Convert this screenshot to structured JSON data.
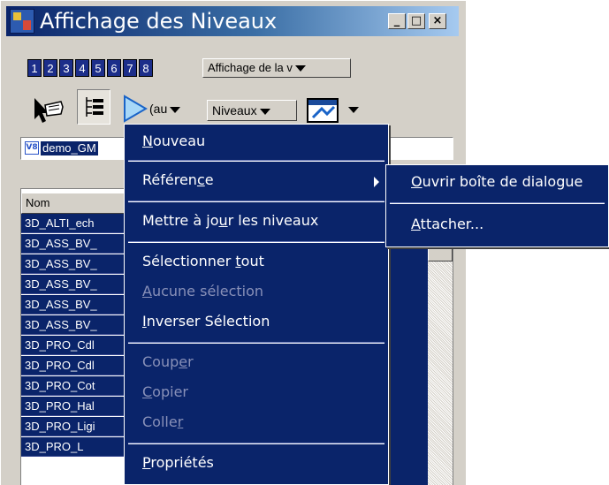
{
  "window": {
    "title": "Affichage des Niveaux",
    "controls": {
      "minimize": "_",
      "maximize": "□",
      "close": "×"
    }
  },
  "toolbar_row1": {
    "view_buttons": [
      "1",
      "2",
      "3",
      "4",
      "5",
      "6",
      "7",
      "8"
    ],
    "display_dropdown": "Affichage de la v"
  },
  "toolbar_row2": {
    "filter_dropdown": "(au",
    "levels_dropdown": "Niveaux"
  },
  "file_field": {
    "badge": "V8",
    "label": "demo_GM"
  },
  "list": {
    "column_header": "Nom",
    "rows": [
      "3D_ALTI_ech",
      "3D_ASS_BV_",
      "3D_ASS_BV_",
      "3D_ASS_BV_",
      "3D_ASS_BV_",
      "3D_ASS_BV_",
      "3D_PRO_Cdl",
      "3D_PRO_Cdl",
      "3D_PRO_Cot",
      "3D_PRO_Hal",
      "3D_PRO_Ligi",
      "3D_PRO_L"
    ]
  },
  "context_menu": {
    "items": [
      {
        "pre": "",
        "mn": "N",
        "post": "ouveau",
        "disabled": false
      },
      {
        "pre": "Référen",
        "mn": "c",
        "post": "e",
        "disabled": false,
        "submenu": true
      },
      {
        "pre": "Mettre à jo",
        "mn": "u",
        "post": "r les niveaux",
        "disabled": false
      },
      {
        "pre": "Sélectionner ",
        "mn": "t",
        "post": "out",
        "disabled": false
      },
      {
        "pre": "",
        "mn": "A",
        "post": "ucune sélection",
        "disabled": true
      },
      {
        "pre": "",
        "mn": "I",
        "post": "nverser Sélection",
        "disabled": false
      },
      {
        "pre": "Coup",
        "mn": "e",
        "post": "r",
        "disabled": true
      },
      {
        "pre": "",
        "mn": "C",
        "post": "opier",
        "disabled": true
      },
      {
        "pre": "Colle",
        "mn": "r",
        "post": "",
        "disabled": true
      },
      {
        "pre": "",
        "mn": "P",
        "post": "ropriétés",
        "disabled": false
      }
    ]
  },
  "submenu": {
    "items": [
      {
        "pre": "",
        "mn": "O",
        "post": "uvrir boîte de dialogue"
      },
      {
        "pre": "",
        "mn": "A",
        "post": "ttacher..."
      }
    ]
  },
  "colors": {
    "selection": "#0a246a",
    "face": "#d4d0c8",
    "title_start": "#0a246a",
    "title_end": "#a6caf0"
  },
  "icons": [
    "app-icon",
    "pointer-icon",
    "level-display-icon",
    "level-tree-icon",
    "filter-icon",
    "level-manager-icon",
    "chevron-down-icon",
    "submenu-arrow-icon",
    "v8-file-icon"
  ]
}
